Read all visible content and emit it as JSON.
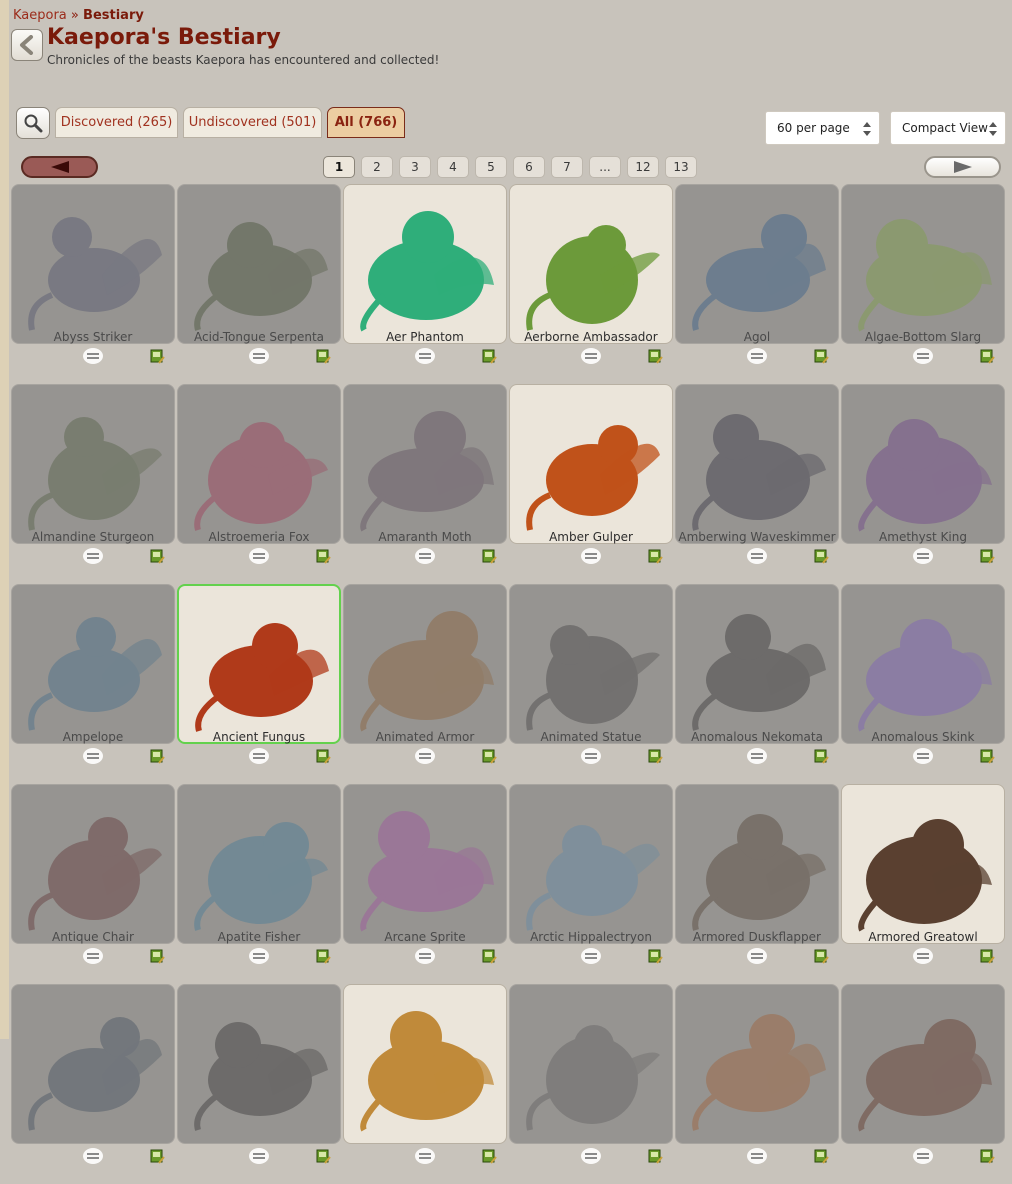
{
  "breadcrumb": {
    "parent": "Kaepora",
    "separator": "»",
    "current": "Bestiary"
  },
  "page_title": "Kaepora's Bestiary",
  "subtitle": "Chronicles of the beasts Kaepora has encountered and collected!",
  "tabs": [
    {
      "label": "Discovered (265)",
      "active": false
    },
    {
      "label": "Undiscovered (501)",
      "active": false
    },
    {
      "label": "All (766)",
      "active": true
    }
  ],
  "per_page": {
    "selected": "60 per page"
  },
  "view_mode": {
    "selected": "Compact View"
  },
  "pagination": {
    "pages": [
      "1",
      "2",
      "3",
      "4",
      "5",
      "6",
      "7",
      "...",
      "12",
      "13"
    ],
    "current": "1"
  },
  "beasts": [
    {
      "name": "Abyss Striker",
      "discovered": false,
      "color": "#4a4f6a"
    },
    {
      "name": "Acid-Tongue Serpenta",
      "discovered": false,
      "color": "#3c4a2c"
    },
    {
      "name": "Aer Phantom",
      "discovered": true,
      "color": "#2fae7a"
    },
    {
      "name": "Aerborne Ambassador",
      "discovered": true,
      "color": "#6c9a3a"
    },
    {
      "name": "Agol",
      "discovered": false,
      "color": "#2a5a8a"
    },
    {
      "name": "Algae-Bottom Slarg",
      "discovered": false,
      "color": "#7aa33a"
    },
    {
      "name": "Almandine Sturgeon",
      "discovered": false,
      "color": "#4a5a3a"
    },
    {
      "name": "Alstroemeria Fox",
      "discovered": false,
      "color": "#a03050"
    },
    {
      "name": "Amaranth Moth",
      "discovered": false,
      "color": "#5a4a5a"
    },
    {
      "name": "Amber Gulper",
      "discovered": true,
      "color": "#c0521a"
    },
    {
      "name": "Amberwing Waveskimmer",
      "discovered": false,
      "color": "#2a2a3a"
    },
    {
      "name": "Amethyst King",
      "discovered": false,
      "color": "#6a3a8a"
    },
    {
      "name": "Ampelope",
      "discovered": false,
      "color": "#3a6a8a"
    },
    {
      "name": "Ancient Fungus",
      "discovered": true,
      "highlight": true,
      "color": "#b03a1a"
    },
    {
      "name": "Animated Armor",
      "discovered": false,
      "color": "#8a5a2a"
    },
    {
      "name": "Animated Statue",
      "discovered": false,
      "color": "#3a3a3a"
    },
    {
      "name": "Anomalous Nekomata",
      "discovered": false,
      "color": "#2a2a2a"
    },
    {
      "name": "Anomalous Skink",
      "discovered": false,
      "color": "#7a5ac0"
    },
    {
      "name": "Antique Chair",
      "discovered": false,
      "color": "#5a2a2a"
    },
    {
      "name": "Apatite Fisher",
      "discovered": false,
      "color": "#3a7a9a"
    },
    {
      "name": "Arcane Sprite",
      "discovered": false,
      "color": "#a04aa0"
    },
    {
      "name": "Arctic Hippalectryon",
      "discovered": false,
      "color": "#5a8aaa"
    },
    {
      "name": "Armored Duskflapper",
      "discovered": false,
      "color": "#4a3a2a"
    },
    {
      "name": "Armored Greatowl",
      "discovered": true,
      "color": "#5a4030"
    },
    {
      "name": "",
      "discovered": false,
      "color": "#3a4a5a"
    },
    {
      "name": "",
      "discovered": false,
      "color": "#2a2a2a"
    },
    {
      "name": "",
      "discovered": true,
      "color": "#c08a3a"
    },
    {
      "name": "",
      "discovered": false,
      "color": "#5a5a5a"
    },
    {
      "name": "",
      "discovered": false,
      "color": "#a05a2a"
    },
    {
      "name": "",
      "discovered": false,
      "color": "#5a2a1a"
    }
  ]
}
